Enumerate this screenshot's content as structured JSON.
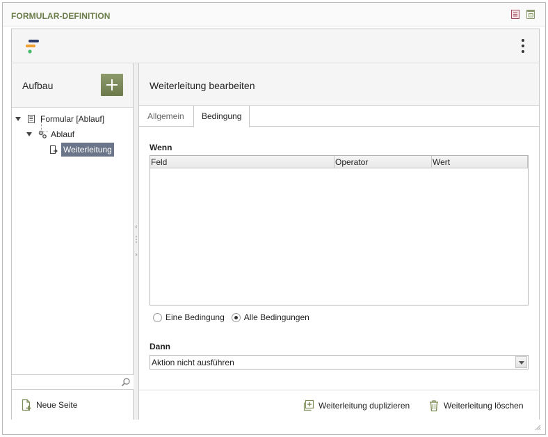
{
  "window": {
    "title": "FORMULAR-DEFINITION"
  },
  "colors": {
    "accent": "#6c7a4c",
    "selection": "#6b7589",
    "title": "#6a7d48"
  },
  "left": {
    "title": "Aufbau",
    "tree": [
      {
        "label": "Formular [Ablauf]",
        "icon": "form-icon"
      },
      {
        "label": "Ablauf",
        "icon": "gears-icon"
      },
      {
        "label": "Weiterleitung",
        "icon": "redirect-icon",
        "selected": true
      }
    ],
    "search": {
      "value": "",
      "placeholder": ""
    },
    "footer": {
      "new_page_label": "Neue Seite"
    }
  },
  "right": {
    "title": "Weiterleitung bearbeiten",
    "tabs": [
      {
        "label": "Allgemein",
        "active": false
      },
      {
        "label": "Bedingung",
        "active": true
      }
    ],
    "wenn": {
      "label": "Wenn",
      "columns": [
        "Feld",
        "Operator",
        "Wert"
      ]
    },
    "condition_mode": {
      "options": [
        {
          "label": "Eine Bedingung",
          "selected": false
        },
        {
          "label": "Alle Bedingungen",
          "selected": true
        }
      ]
    },
    "dann": {
      "label": "Dann",
      "selected_value": "Aktion nicht ausführen"
    },
    "footer": {
      "duplicate_label": "Weiterleitung duplizieren",
      "delete_label": "Weiterleitung löschen"
    }
  }
}
